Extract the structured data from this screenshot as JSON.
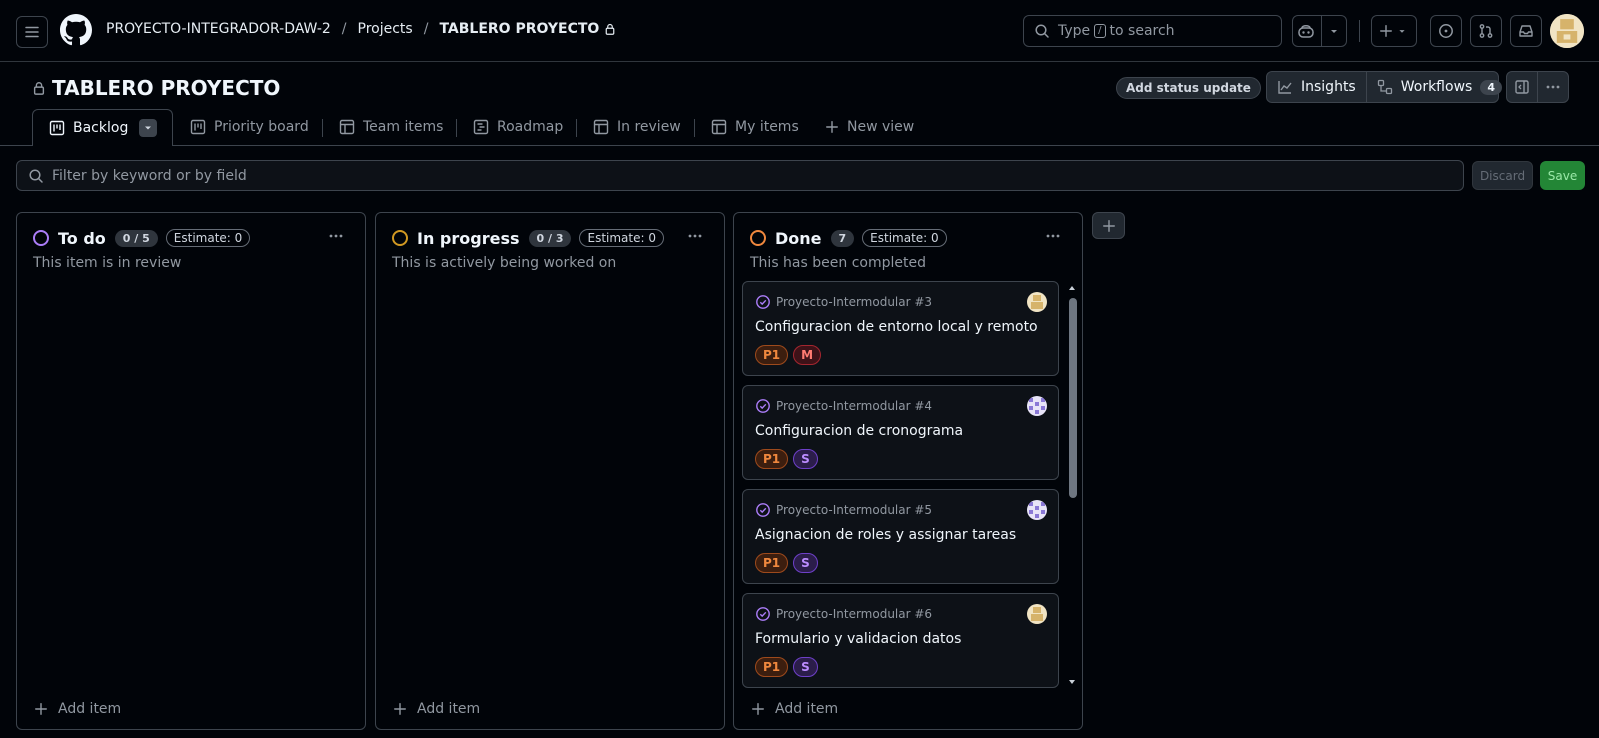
{
  "header": {
    "breadcrumb": {
      "owner": "PROYECTO-INTEGRADOR-DAW-2",
      "projects": "Projects",
      "project": "TABLERO PROYECTO"
    },
    "search": {
      "prefix": "Type",
      "kbd": "/",
      "suffix": "to search"
    }
  },
  "project": {
    "title": "TABLERO PROYECTO",
    "status_update_label": "Add status update",
    "insights_label": "Insights",
    "workflows_label": "Workflows",
    "workflows_count": "4"
  },
  "views": [
    {
      "label": "Backlog",
      "icon": "board-icon",
      "active": true
    },
    {
      "label": "Priority board",
      "icon": "board-icon"
    },
    {
      "label": "Team items",
      "icon": "table-icon"
    },
    {
      "label": "Roadmap",
      "icon": "roadmap-icon"
    },
    {
      "label": "In review",
      "icon": "table-icon"
    },
    {
      "label": "My items",
      "icon": "table-icon"
    },
    {
      "label": "New view",
      "icon": "plus-icon"
    }
  ],
  "filter": {
    "placeholder": "Filter by keyword or by field",
    "discard_label": "Discard",
    "save_label": "Save"
  },
  "columns": [
    {
      "name": "To do",
      "count": "0 / 5",
      "estimate": "Estimate: 0",
      "description": "This item is in review",
      "color": "#ab7df8",
      "add_label": "Add item"
    },
    {
      "name": "In progress",
      "count": "0 / 3",
      "estimate": "Estimate: 0",
      "description": "This is actively being worked on",
      "color": "#d29922",
      "add_label": "Add item"
    },
    {
      "name": "Done",
      "count": "7",
      "estimate": "Estimate: 0",
      "description": "This has been completed",
      "color": "#f0883e",
      "add_label": "Add item",
      "cards": [
        {
          "repo": "Proyecto-Intermodular #3",
          "title": "Configuracion de entorno local y remoto",
          "labels": [
            "P1",
            "M"
          ]
        },
        {
          "repo": "Proyecto-Intermodular #4",
          "title": "Configuracion de cronograma",
          "labels": [
            "P1",
            "S"
          ]
        },
        {
          "repo": "Proyecto-Intermodular #5",
          "title": "Asignacion de roles y assignar tareas",
          "labels": [
            "P1",
            "S"
          ]
        },
        {
          "repo": "Proyecto-Intermodular #6",
          "title": "Formulario y validacion datos",
          "labels": [
            "P1",
            "S"
          ]
        }
      ]
    }
  ],
  "colors": {
    "background": "#010409",
    "border": "#3d444d",
    "accent_green": "#238636",
    "issue_closed": "#ab7df8"
  }
}
